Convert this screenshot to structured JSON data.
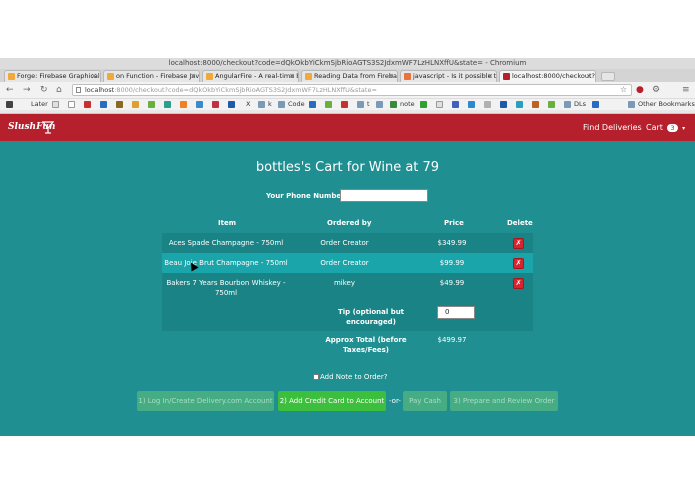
{
  "browser": {
    "window_title": "localhost:8000/checkout?code=dQkOkbYiCkmSjbRioAGTS3S2JdxmWF7LzHLNXffU&state= - Chromium",
    "tabs": [
      {
        "label": "Forge: Firebase Graphical",
        "icon_color": "#f2a93b"
      },
      {
        "label": "on Function - Firebase Java",
        "icon_color": "#f2a93b"
      },
      {
        "label": "AngularFire - A real-time b",
        "icon_color": "#f2a93b"
      },
      {
        "label": "Reading Data from Fireba",
        "icon_color": "#f2a93b"
      },
      {
        "label": "javascript - Is it possible to",
        "icon_color": "#e8743b"
      },
      {
        "label": "localhost:8000/checkout?",
        "icon_color": "#b5202c"
      }
    ],
    "url_host": "localhost",
    "url_rest": ":8000/checkout?code=dQkOkbYiCkmSjbRioAGTS3S2JdxmWF7LzHLNXffU&state=",
    "bookmarks": [
      {
        "label": "Later",
        "icon_color": "#444444"
      },
      {
        "label": "X",
        "icon_color": "#1e5aa8"
      },
      {
        "label": "k",
        "icon_color": "#7a9ab8"
      },
      {
        "label": "Code",
        "icon_color": "#7a9ab8"
      },
      {
        "label": "t",
        "icon_color": "#7a9ab8"
      },
      {
        "label": "note",
        "icon_color": "#3a8a3a"
      },
      {
        "label": "DLs",
        "icon_color": "#7a9ab8"
      },
      {
        "label": "Other Bookmarks",
        "icon_color": "#7a9ab8"
      }
    ]
  },
  "nav": {
    "brand": "SlushFun",
    "find_deliveries": "Find Deliveries",
    "cart_label": "Cart",
    "cart_count": "3",
    "caret": "▾"
  },
  "page": {
    "title": "bottles's Cart for Wine at 79",
    "phone_label": "Your Phone Number:",
    "phone_value": ""
  },
  "table": {
    "headers": [
      "Item",
      "Ordered by",
      "Price",
      "Delete"
    ],
    "rows": [
      {
        "item": "Aces Spade Champagne - 750ml",
        "ordered_by": "Order Creator",
        "price": "$349.99"
      },
      {
        "item": "Beau Joie Brut Champagne - 750ml",
        "ordered_by": "Order Creator",
        "price": "$99.99"
      },
      {
        "item": "Bakers 7 Years Bourbon Whiskey - 750ml",
        "ordered_by": "mikey",
        "price": "$49.99"
      }
    ],
    "delete_symbol": "✗",
    "tip_label": "Tip (optional but encouraged)",
    "tip_value": "0",
    "total_label": "Approx Total (before Taxes/Fees)",
    "total_value": "$499.97"
  },
  "note": {
    "label": "Add Note to Order?",
    "checked": false
  },
  "actions": {
    "login_button": "1) Log In/Create Delivery.com Account",
    "add_card_button": "2) Add Credit Card to Account",
    "or_text": "-or-",
    "pay_cash_button": "Pay Cash",
    "prepare_button": "3) Prepare and Review Order"
  },
  "colors": {
    "navbar": "#b5202c",
    "content_bg": "#1f8f91",
    "highlight_row": "#1aa5aa",
    "primary_button": "#3cbf3c",
    "delete_button": "#d9242f"
  }
}
